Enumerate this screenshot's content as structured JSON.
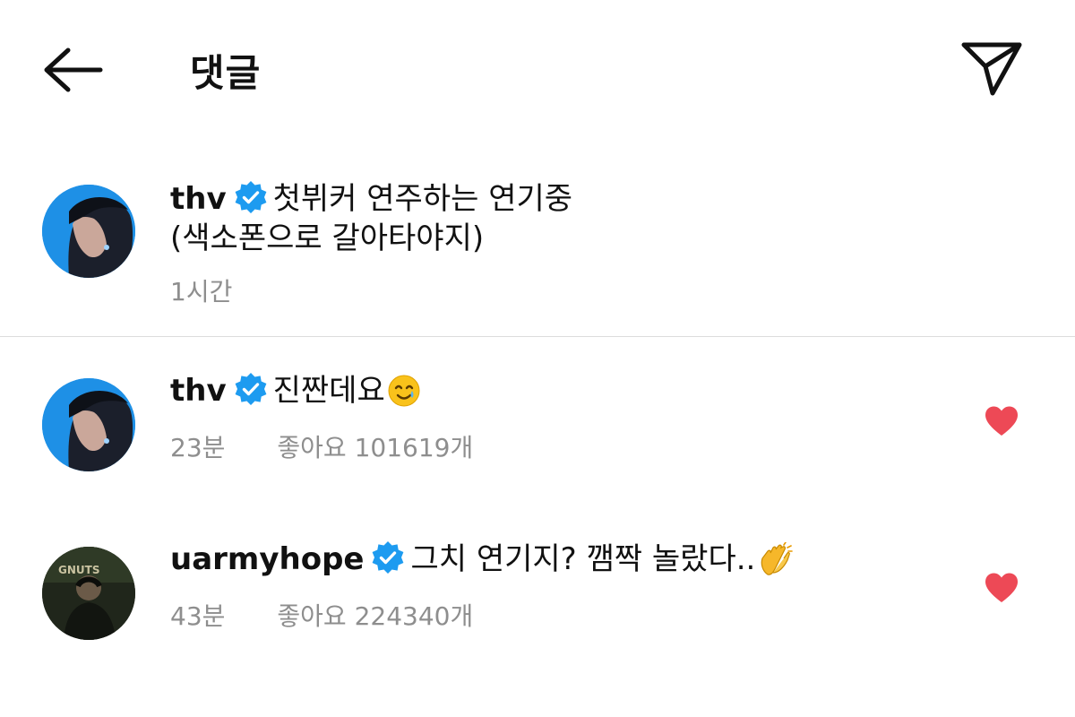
{
  "header": {
    "title": "댓글",
    "back_icon": "arrow-left-icon",
    "share_icon": "paper-plane-icon"
  },
  "caption": {
    "username": "thv",
    "text_line1": "첫뷔커 연주하는 연기중",
    "text_line2": "(색소폰으로 갈아타야지)",
    "time": "1시간"
  },
  "comments": [
    {
      "username": "thv",
      "text": "진짠데요",
      "emoji": "smiling-face-with-tear",
      "time": "23분",
      "likes": "좋아요 101619개",
      "liked": true
    },
    {
      "username": "uarmyhope",
      "text": "그치 연기지? 깸짝 놀랐다..",
      "emoji": "clapping-hands",
      "time": "43분",
      "likes": "좋아요 224340개",
      "liked": true
    }
  ],
  "colors": {
    "heart": "#ed4956",
    "verified": "#1d9bf0",
    "meta_text": "#8e8e8e",
    "thv_avatar_bg": "#1e90e6"
  }
}
